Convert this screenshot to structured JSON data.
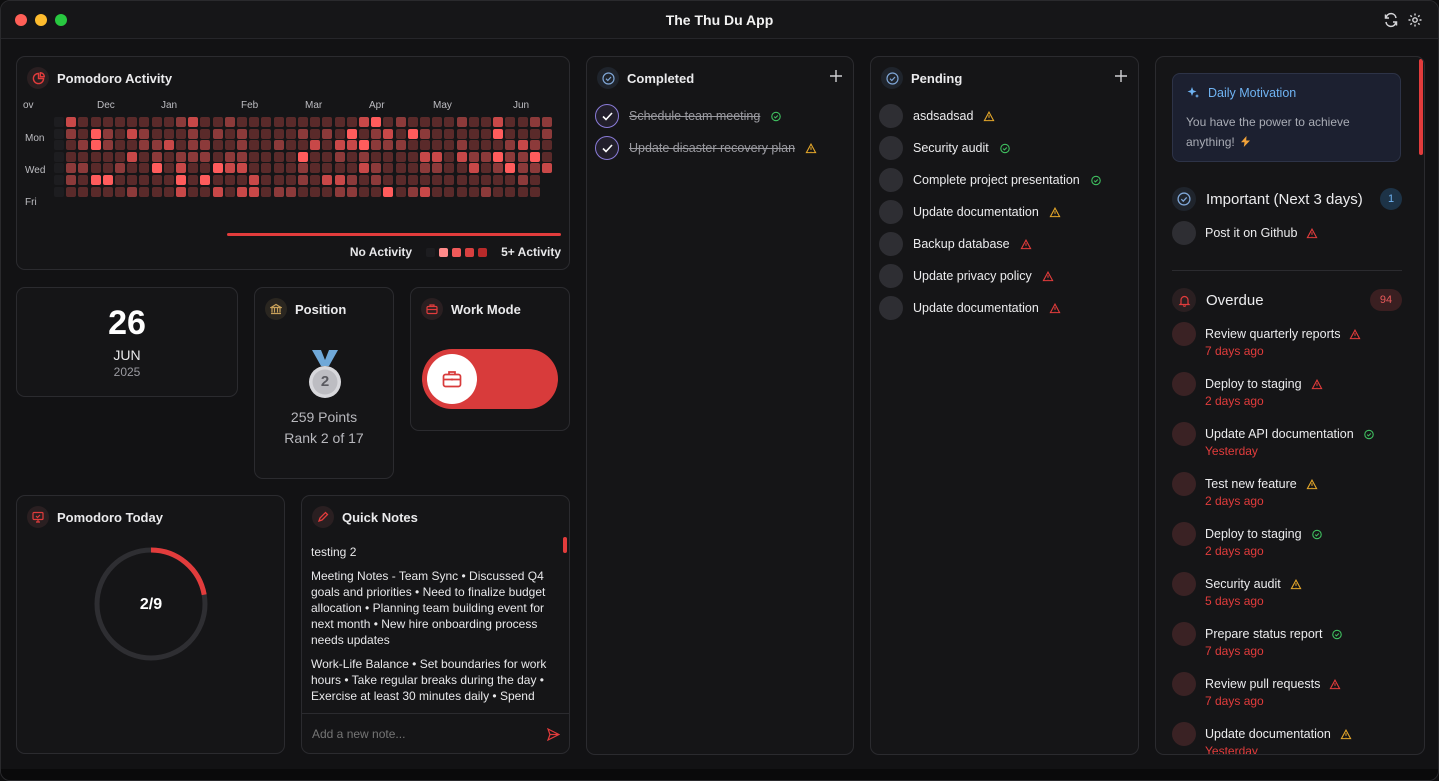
{
  "window": {
    "title": "The Thu Du App"
  },
  "colors": {
    "accent": "#e23c3c",
    "activity": [
      "#5a2a2a",
      "#8c3a3a",
      "#c84848",
      "#ff5c5c"
    ]
  },
  "heatmap": {
    "title": "Pomodoro Activity",
    "months": [
      "ov",
      "Dec",
      "Jan",
      "Feb",
      "Mar",
      "Apr",
      "May",
      "Jun"
    ],
    "days": [
      "Mon",
      "Wed",
      "Fri"
    ],
    "legend_low": "No Activity",
    "legend_high": "5+ Activity"
  },
  "date": {
    "day": "26",
    "month": "JUN",
    "year": "2025"
  },
  "position": {
    "title": "Position",
    "rank_number": "2",
    "points": "259 Points",
    "rank": "Rank 2 of 17"
  },
  "work_mode": {
    "title": "Work Mode",
    "enabled": true
  },
  "pomodoro_today": {
    "title": "Pomodoro Today",
    "label": "2/9",
    "completed": 2,
    "total": 9
  },
  "quick_notes": {
    "title": "Quick Notes",
    "notes": [
      "testing 2",
      "Meeting Notes - Team Sync • Discussed Q4 goals and priorities • Need to finalize budget allocation • Planning team building event for next month • New hire onboarding process needs updates",
      "Work-Life Balance • Set boundaries for work hours • Take regular breaks during the day • Exercise at least 30 minutes daily • Spend"
    ],
    "placeholder": "Add a new note..."
  },
  "completed": {
    "title": "Completed",
    "tasks": [
      {
        "label": "Schedule team meeting",
        "status": "ok"
      },
      {
        "label": "Update disaster recovery plan",
        "status": "warn"
      }
    ]
  },
  "pending": {
    "title": "Pending",
    "tasks": [
      {
        "label": "asdsadsad",
        "status": "warn"
      },
      {
        "label": "Security audit",
        "status": "ok"
      },
      {
        "label": "Complete project presentation",
        "status": "ok"
      },
      {
        "label": "Update documentation",
        "status": "warn"
      },
      {
        "label": "Backup database",
        "status": "alert"
      },
      {
        "label": "Update privacy policy",
        "status": "alert"
      },
      {
        "label": "Update documentation",
        "status": "alert"
      }
    ]
  },
  "motivation": {
    "title": "Daily Motivation",
    "text": "You have the power to achieve anything!"
  },
  "important": {
    "title": "Important (Next 3 days)",
    "count": "1",
    "tasks": [
      {
        "label": "Post it on Github",
        "status": "alert"
      }
    ]
  },
  "overdue": {
    "title": "Overdue",
    "count": "94",
    "tasks": [
      {
        "label": "Review quarterly reports",
        "ago": "7 days ago",
        "status": "alert"
      },
      {
        "label": "Deploy to staging",
        "ago": "2 days ago",
        "status": "alert"
      },
      {
        "label": "Update API documentation",
        "ago": "Yesterday",
        "status": "ok"
      },
      {
        "label": "Test new feature",
        "ago": "2 days ago",
        "status": "warn"
      },
      {
        "label": "Deploy to staging",
        "ago": "2 days ago",
        "status": "ok"
      },
      {
        "label": "Security audit",
        "ago": "5 days ago",
        "status": "warn"
      },
      {
        "label": "Prepare status report",
        "ago": "7 days ago",
        "status": "ok"
      },
      {
        "label": "Review pull requests",
        "ago": "7 days ago",
        "status": "alert"
      },
      {
        "label": "Update documentation",
        "ago": "Yesterday",
        "status": "warn"
      }
    ]
  }
}
